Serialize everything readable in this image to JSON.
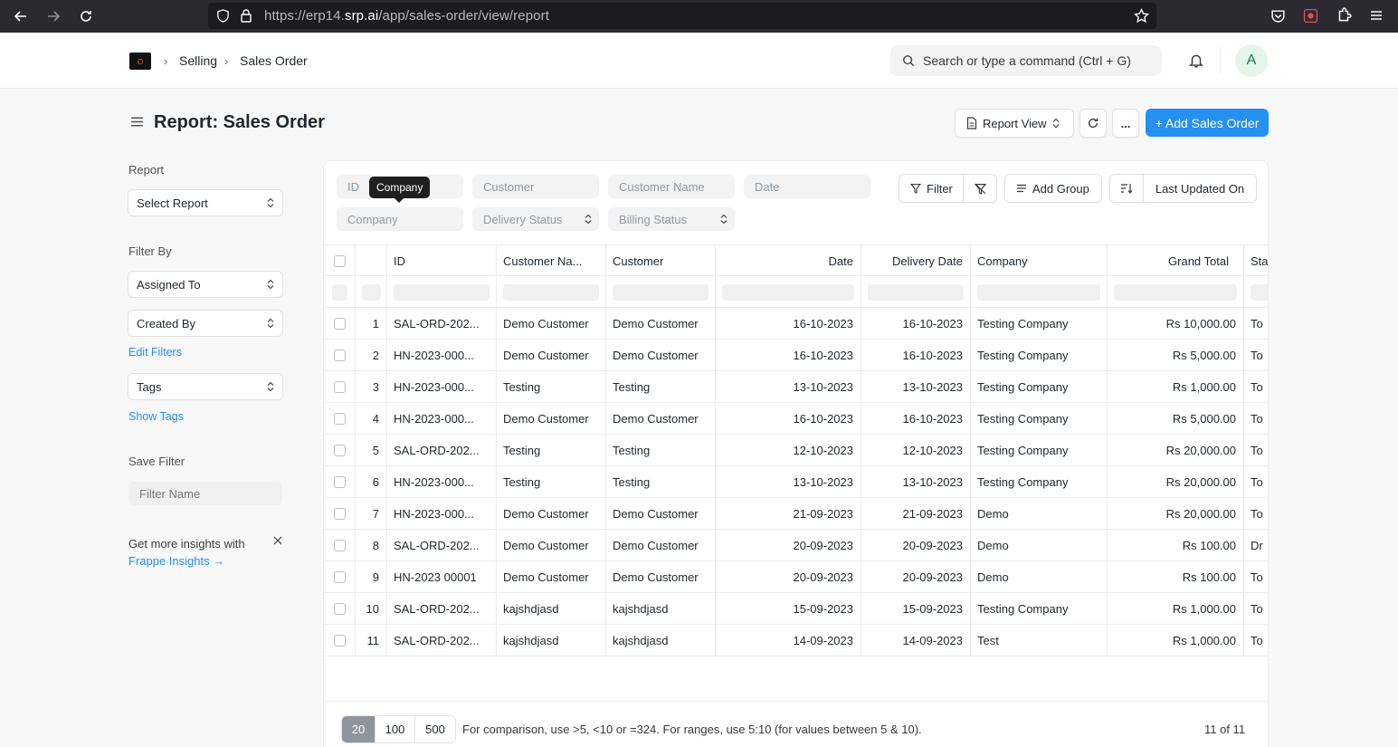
{
  "browser": {
    "url_prefix": "https://erp14.",
    "url_host": "srp.ai",
    "url_path": "/app/sales-order/view/report"
  },
  "header": {
    "breadcrumbs": [
      "Selling",
      "Sales Order"
    ],
    "search_placeholder": "Search or type a command (Ctrl + G)",
    "avatar_initial": "A"
  },
  "page": {
    "title": "Report: Sales Order",
    "view_button": "Report View",
    "more_button": "...",
    "add_button": "+ Add Sales Order"
  },
  "sidebar": {
    "report_label": "Report",
    "select_report": "Select Report",
    "filter_by_label": "Filter By",
    "assigned_to": "Assigned To",
    "created_by": "Created By",
    "edit_filters": "Edit Filters",
    "tags": "Tags",
    "show_tags": "Show Tags",
    "save_filter_label": "Save Filter",
    "filter_name_placeholder": "Filter Name",
    "insights_text": "Get more insights with",
    "insights_link": "Frappe Insights →"
  },
  "filters": {
    "id": "ID",
    "customer": "Customer",
    "customer_name": "Customer Name",
    "date": "Date",
    "company": "Company",
    "delivery_status": "Delivery Status",
    "billing_status": "Billing Status",
    "tooltip": "Company",
    "filter_button": "Filter",
    "add_group": "Add Group",
    "sort_label": "Last Updated On"
  },
  "table": {
    "columns": [
      "ID",
      "Customer Na...",
      "Customer",
      "Date",
      "Delivery Date",
      "Company",
      "Grand Total",
      "Sta"
    ],
    "rows": [
      {
        "n": "1",
        "id": "SAL-ORD-202...",
        "customer_name": "Demo Customer",
        "customer": "Demo Customer",
        "date": "16-10-2023",
        "delivery": "16-10-2023",
        "company": "Testing Company",
        "total": "Rs 10,000.00",
        "status": "To"
      },
      {
        "n": "2",
        "id": "HN-2023-000...",
        "customer_name": "Demo Customer",
        "customer": "Demo Customer",
        "date": "16-10-2023",
        "delivery": "16-10-2023",
        "company": "Testing Company",
        "total": "Rs 5,000.00",
        "status": "To"
      },
      {
        "n": "3",
        "id": "HN-2023-000...",
        "customer_name": "Testing",
        "customer": "Testing",
        "date": "13-10-2023",
        "delivery": "13-10-2023",
        "company": "Testing Company",
        "total": "Rs 1,000.00",
        "status": "To"
      },
      {
        "n": "4",
        "id": "HN-2023-000...",
        "customer_name": "Demo Customer",
        "customer": "Demo Customer",
        "date": "16-10-2023",
        "delivery": "16-10-2023",
        "company": "Testing Company",
        "total": "Rs 5,000.00",
        "status": "To"
      },
      {
        "n": "5",
        "id": "SAL-ORD-202...",
        "customer_name": "Testing",
        "customer": "Testing",
        "date": "12-10-2023",
        "delivery": "12-10-2023",
        "company": "Testing Company",
        "total": "Rs 20,000.00",
        "status": "To"
      },
      {
        "n": "6",
        "id": "HN-2023-000...",
        "customer_name": "Testing",
        "customer": "Testing",
        "date": "13-10-2023",
        "delivery": "13-10-2023",
        "company": "Testing Company",
        "total": "Rs 20,000.00",
        "status": "To"
      },
      {
        "n": "7",
        "id": "HN-2023-000...",
        "customer_name": "Demo Customer",
        "customer": "Demo Customer",
        "date": "21-09-2023",
        "delivery": "21-09-2023",
        "company": "Demo",
        "total": "Rs 20,000.00",
        "status": "To"
      },
      {
        "n": "8",
        "id": "SAL-ORD-202...",
        "customer_name": "Demo Customer",
        "customer": "Demo Customer",
        "date": "20-09-2023",
        "delivery": "20-09-2023",
        "company": "Demo",
        "total": "Rs 100.00",
        "status": "Dr"
      },
      {
        "n": "9",
        "id": "HN-2023 00001",
        "customer_name": "Demo Customer",
        "customer": "Demo Customer",
        "date": "20-09-2023",
        "delivery": "20-09-2023",
        "company": "Demo",
        "total": "Rs 100.00",
        "status": "To"
      },
      {
        "n": "10",
        "id": "SAL-ORD-202...",
        "customer_name": "kajshdjasd",
        "customer": "kajshdjasd",
        "date": "15-09-2023",
        "delivery": "15-09-2023",
        "company": "Testing Company",
        "total": "Rs 1,000.00",
        "status": "To"
      },
      {
        "n": "11",
        "id": "SAL-ORD-202...",
        "customer_name": "kajshdjasd",
        "customer": "kajshdjasd",
        "date": "14-09-2023",
        "delivery": "14-09-2023",
        "company": "Test",
        "total": "Rs 1,000.00",
        "status": "To"
      }
    ]
  },
  "footer": {
    "page_sizes": [
      "20",
      "100",
      "500"
    ],
    "active_page_size": "20",
    "hint": "For comparison, use >5, <10 or =324. For ranges, use 5:10 (for values between 5 & 10).",
    "count": "11 of 11"
  },
  "colors": {
    "primary": "#2490ef",
    "browser_chrome": "#2b2a33"
  }
}
